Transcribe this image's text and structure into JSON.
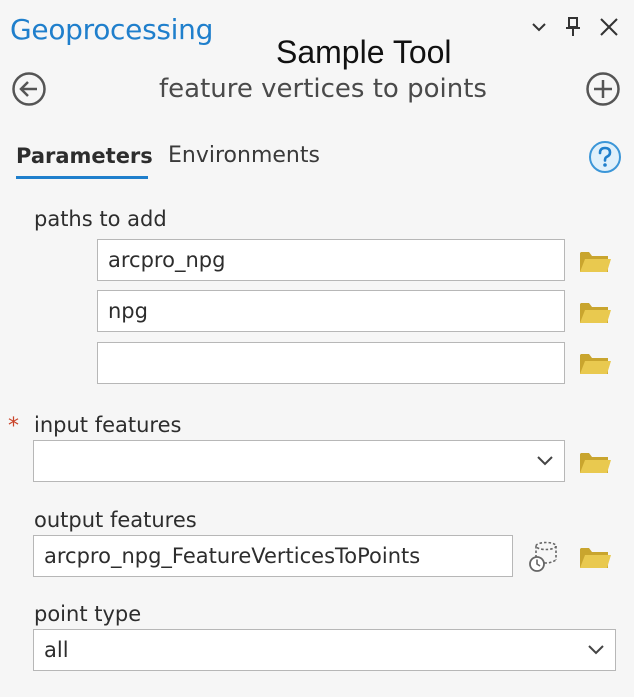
{
  "header": {
    "pane_title": "Geoprocessing",
    "overlay_title": "Sample Tool",
    "tool_title": "feature vertices to points"
  },
  "tabs": [
    {
      "label": "Parameters",
      "active": true
    },
    {
      "label": "Environments",
      "active": false
    }
  ],
  "parameters": {
    "paths_label": "paths to add",
    "paths": [
      "arcpro_npg",
      "npg",
      ""
    ],
    "input_label": "input features",
    "input_required_mark": "*",
    "input_value": "",
    "output_label": "output features",
    "output_value": "arcpro_npg_FeatureVerticesToPoints",
    "point_type_label": "point type",
    "point_type_value": "all"
  },
  "icons": {
    "minimize": "chevron-down-icon",
    "pin": "pin-icon",
    "close": "close-icon",
    "back": "back-arrow-icon",
    "add": "plus-circle-icon",
    "help": "help-icon",
    "folder": "folder-icon",
    "dataset": "dataset-properties-icon"
  },
  "colors": {
    "accent": "#1f7fcc",
    "required": "#c9442a",
    "folder": "#e3c44a"
  }
}
